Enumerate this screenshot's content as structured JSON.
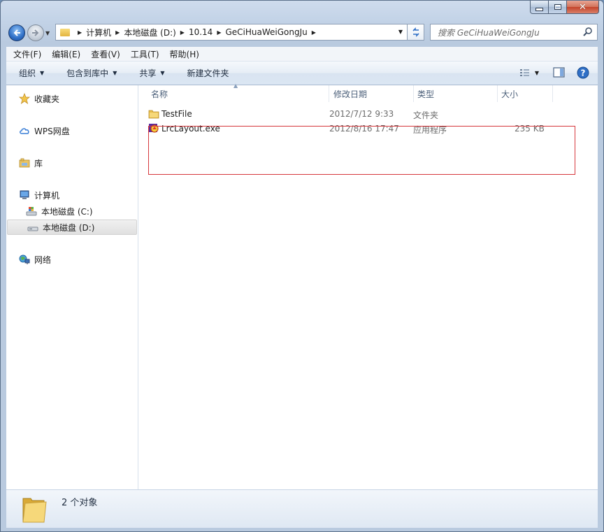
{
  "window": {
    "minimize_glyph": "",
    "maximize_glyph": "",
    "close_glyph": "✕"
  },
  "address": {
    "crumbs": [
      "计算机",
      "本地磁盘 (D:)",
      "10.14",
      "GeCiHuaWeiGongJu"
    ],
    "search_placeholder": "搜索 GeCiHuaWeiGongJu"
  },
  "menubar": {
    "items": [
      "文件(F)",
      "编辑(E)",
      "查看(V)",
      "工具(T)",
      "帮助(H)"
    ]
  },
  "toolbar": {
    "organize": "组织",
    "include_in_library": "包含到库中",
    "share": "共享",
    "new_folder": "新建文件夹"
  },
  "navpane": {
    "favorites": "收藏夹",
    "wps": "WPS网盘",
    "libraries": "库",
    "computer": "计算机",
    "drive_c": "本地磁盘 (C:)",
    "drive_d": "本地磁盘 (D:)",
    "network": "网络"
  },
  "columns": {
    "name": "名称",
    "modified": "修改日期",
    "type": "类型",
    "size": "大小"
  },
  "files": [
    {
      "name": "TestFile",
      "modified": "2012/7/12 9:33",
      "type": "文件夹",
      "size": "",
      "icon": "folder-icon"
    },
    {
      "name": "LrcLayout.exe",
      "modified": "2012/8/16 17:47",
      "type": "应用程序",
      "size": "235 KB",
      "icon": "exe-icon"
    }
  ],
  "details": {
    "status": "2 个对象"
  },
  "colors": {
    "highlight_box": "#d6373c",
    "folder": "#e8bd4b",
    "accent": "#2f6fc6"
  }
}
